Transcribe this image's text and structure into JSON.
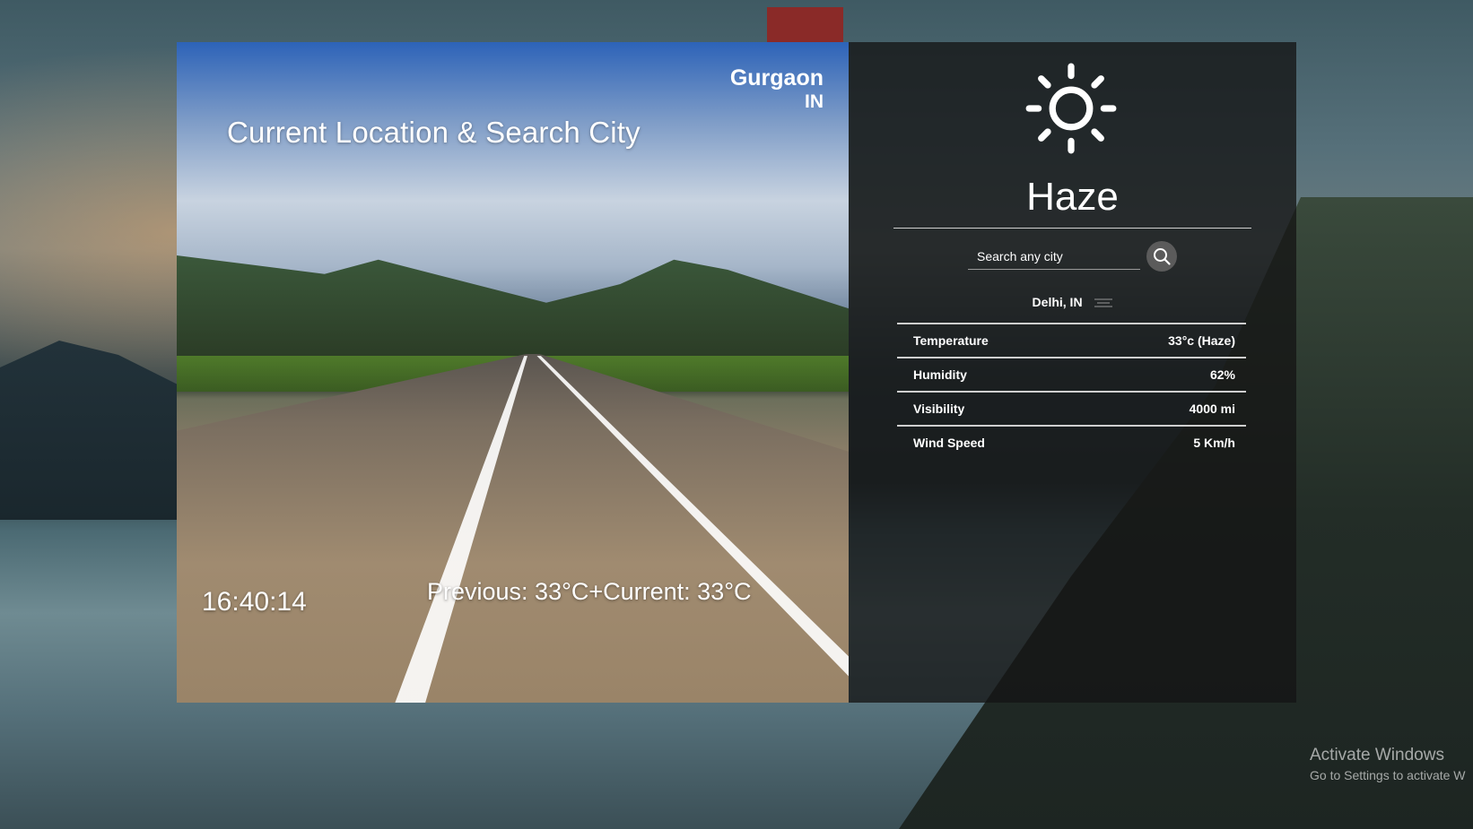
{
  "location": {
    "city": "Gurgaon",
    "country": "IN"
  },
  "hero": {
    "title": "Current Location & Search City",
    "clock": "16:40:14",
    "temperature_compare": "Previous: 33°C+Current: 33°C"
  },
  "weather": {
    "icon": "sun-icon",
    "condition": "Haze",
    "search_placeholder": "Search any city",
    "selected_location": "Delhi, IN",
    "stats": [
      {
        "label": "Temperature",
        "value": "33°c (Haze)"
      },
      {
        "label": "Humidity",
        "value": "62%"
      },
      {
        "label": "Visibility",
        "value": "4000 mi"
      },
      {
        "label": "Wind Speed",
        "value": "5 Km/h"
      }
    ]
  },
  "os_watermark": {
    "line1": "Activate Windows",
    "line2": "Go to Settings to activate W"
  }
}
